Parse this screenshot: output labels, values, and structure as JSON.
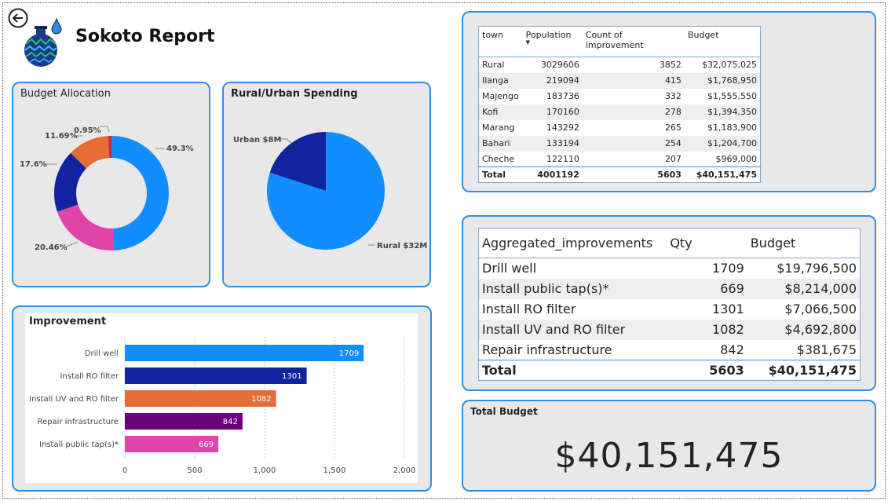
{
  "header": {
    "title": "Sokoto Report",
    "back_icon": "arrow-left-circle-icon",
    "logo_icon": "water-drop-pot-logo"
  },
  "budget_allocation": {
    "title": "Budget Allocation",
    "chart_data": {
      "type": "pie",
      "donut": true,
      "slices": [
        {
          "label": "49.3%",
          "value": 49.3,
          "color": "#118DFF"
        },
        {
          "label": "20.46%",
          "value": 20.46,
          "color": "#E044A7"
        },
        {
          "label": "17.6%",
          "value": 17.6,
          "color": "#12239E"
        },
        {
          "label": "11.69%",
          "value": 11.69,
          "color": "#E66C37"
        },
        {
          "label": "0.95%",
          "value": 0.95,
          "color": "#C4283A"
        }
      ]
    }
  },
  "rural_urban": {
    "title": "Rural/Urban Spending",
    "chart_data": {
      "type": "pie",
      "slices": [
        {
          "label": "Rural $32M",
          "value": 32,
          "color": "#118DFF"
        },
        {
          "label": "Urban $8M",
          "value": 8,
          "color": "#12239E"
        }
      ]
    }
  },
  "improvement": {
    "title": "Improvement",
    "chart_data": {
      "type": "bar",
      "orientation": "horizontal",
      "categories": [
        "Drill well",
        "Install RO filter",
        "Install UV and RO filter",
        "Repair infrastructure",
        "Install public tap(s)*"
      ],
      "values": [
        1709,
        1301,
        1082,
        842,
        669
      ],
      "colors": [
        "#118DFF",
        "#12239E",
        "#E66C37",
        "#6B007B",
        "#E044A7"
      ],
      "xticks": [
        "0",
        "500",
        "1,000",
        "1,500",
        "2,000"
      ],
      "xlim": [
        0,
        2000
      ],
      "grid": true
    }
  },
  "town_table": {
    "headers": [
      "town",
      "Population",
      "Count of improvement",
      "Budget"
    ],
    "rows": [
      [
        "Rural",
        "3029606",
        "3852",
        "$32,075,025"
      ],
      [
        "Ilanga",
        "219094",
        "415",
        "$1,768,950"
      ],
      [
        "Majengo",
        "183736",
        "332",
        "$1,555,550"
      ],
      [
        "Kofi",
        "170160",
        "278",
        "$1,394,350"
      ],
      [
        "Marang",
        "143292",
        "265",
        "$1,183,900"
      ],
      [
        "Bahari",
        "133194",
        "254",
        "$1,204,700"
      ],
      [
        "Cheche",
        "122110",
        "207",
        "$969,000"
      ]
    ],
    "total": [
      "Total",
      "4001192",
      "5603",
      "$40,151,475"
    ]
  },
  "agg_table": {
    "headers": [
      "Aggregated_improvements",
      "Qty",
      "Budget"
    ],
    "rows": [
      [
        "Drill well",
        "1709",
        "$19,796,500"
      ],
      [
        "Install public tap(s)*",
        "669",
        "$8,214,000"
      ],
      [
        "Install RO filter",
        "1301",
        "$7,066,500"
      ],
      [
        "Install UV and RO filter",
        "1082",
        "$4,692,800"
      ],
      [
        "Repair infrastructure",
        "842",
        "$381,675"
      ]
    ],
    "total": [
      "Total",
      "5603",
      "$40,151,475"
    ]
  },
  "total_budget": {
    "title": "Total Budget",
    "value": "$40,151,475"
  }
}
